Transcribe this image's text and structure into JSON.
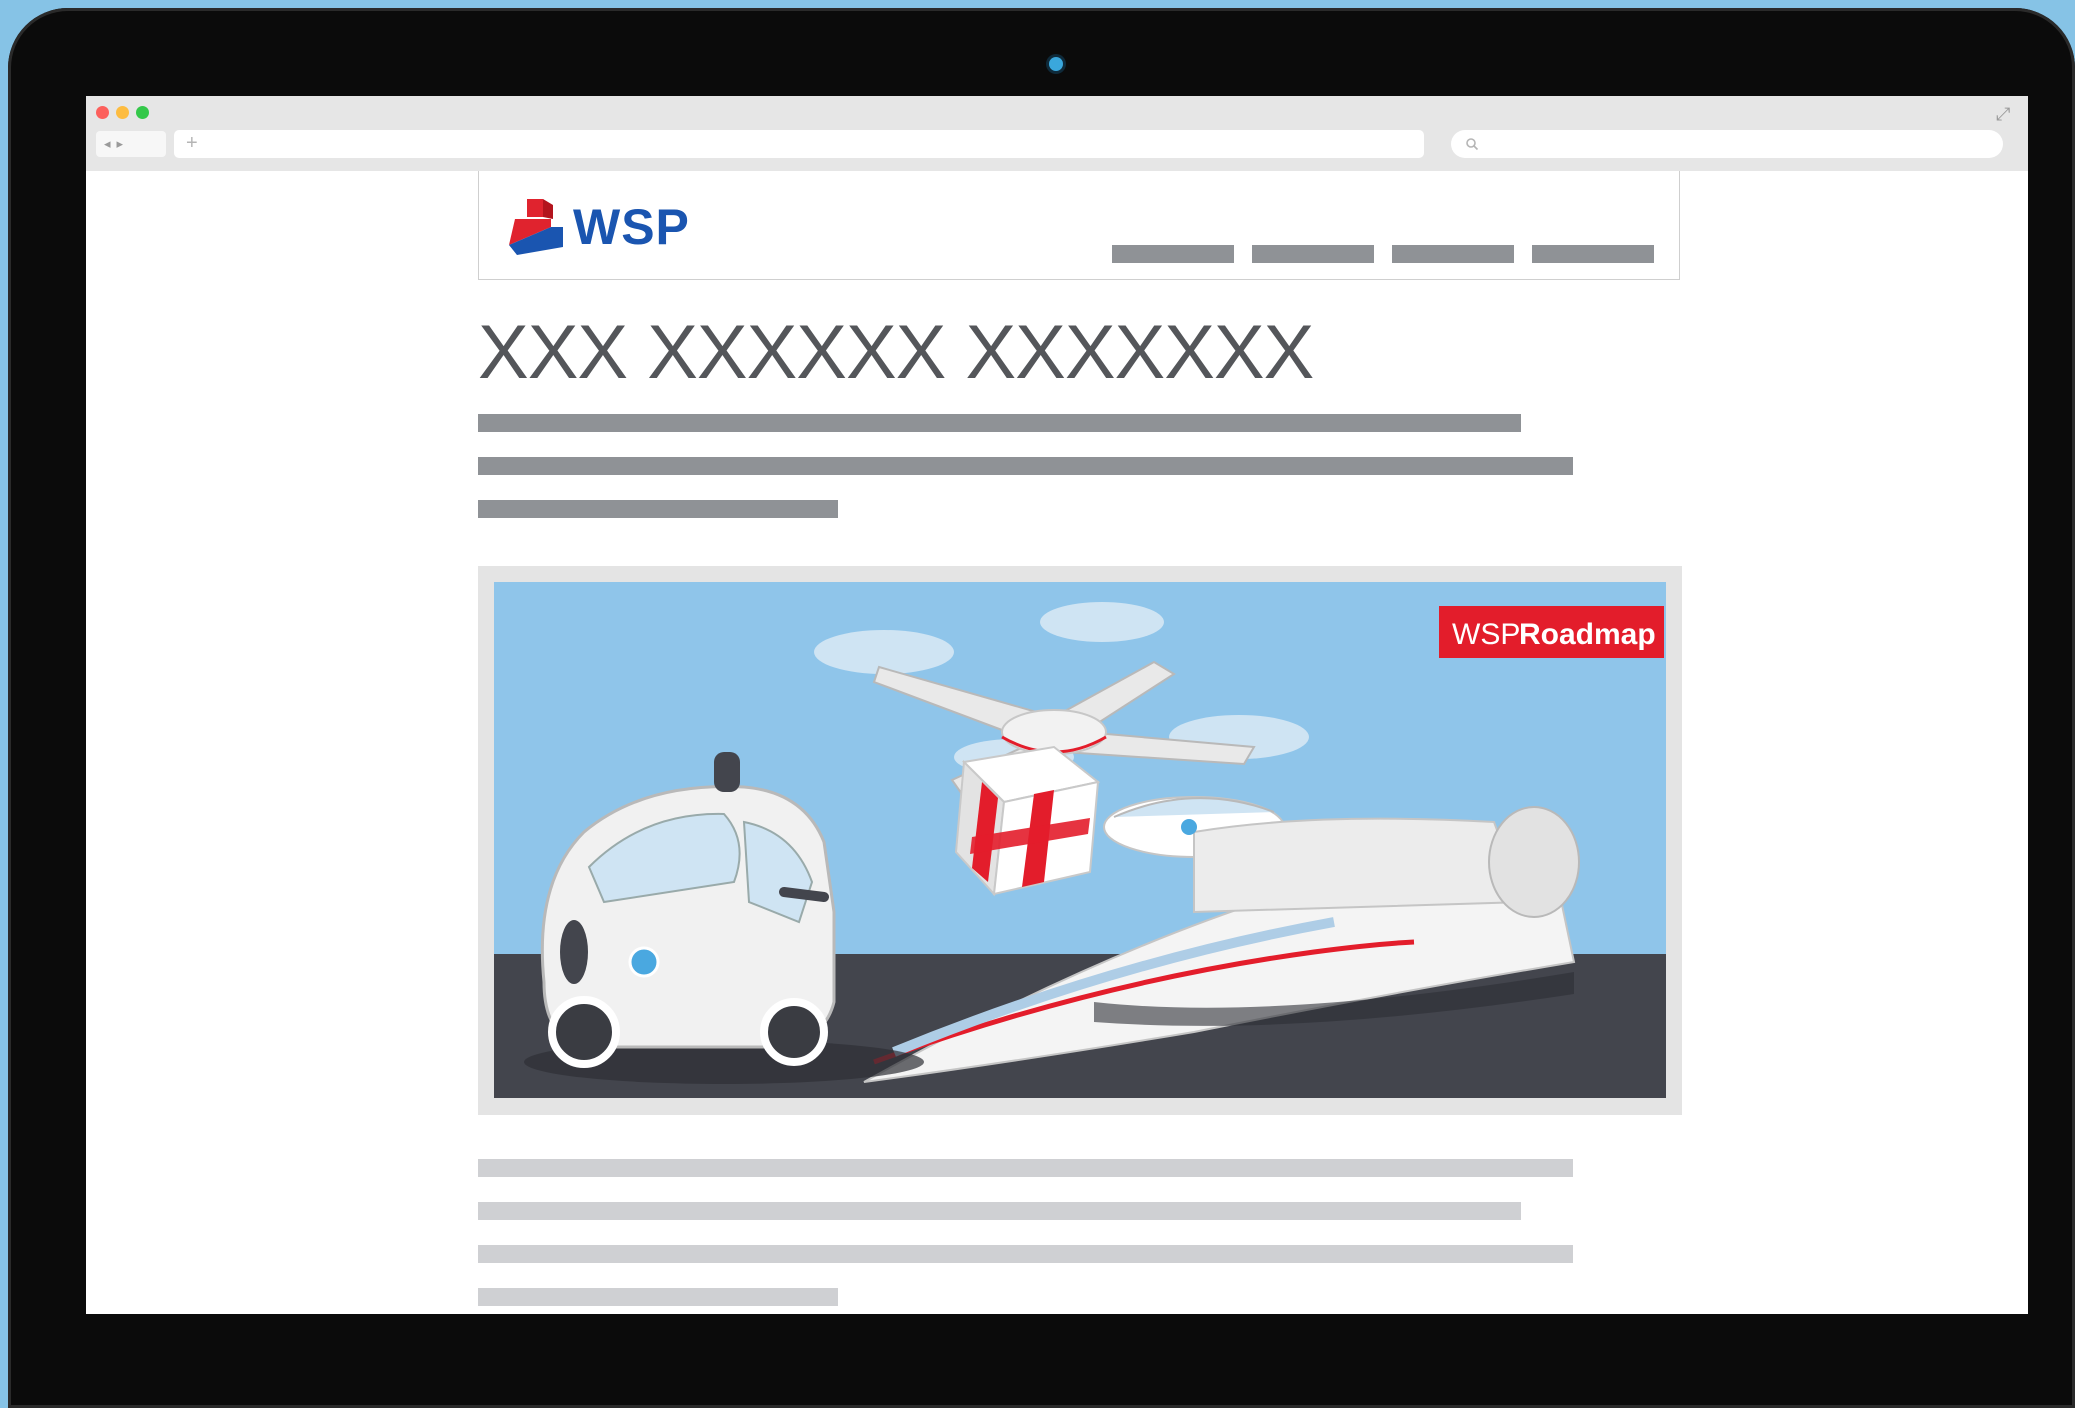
{
  "browser": {
    "back_icon": "back-arrow-icon",
    "forward_icon": "forward-arrow-icon",
    "new_tab_symbol": "+",
    "search_icon": "magnifier-icon",
    "expand_icon": "expand-arrows-icon"
  },
  "site": {
    "logo_text": "WSP",
    "logo_colors": {
      "red": "#e0232e",
      "blue": "#1a55b0"
    },
    "nav_items": [
      "",
      "",
      "",
      ""
    ]
  },
  "article": {
    "title": "XXX XXXXXX XXXXXXX",
    "intro_lines": 3,
    "body_lines": 4
  },
  "hero_image": {
    "badge_text_light": "WSP",
    "badge_text_bold": "Roadmap",
    "badge_color": "#e31d2b",
    "sky_color": "#8fc5ea",
    "road_color": "#43454d",
    "subjects": [
      "drone",
      "gift-box",
      "self-driving-car",
      "high-speed-train"
    ]
  },
  "colors": {
    "background": "#86c3e6",
    "laptop_bezel": "#0b0b0b",
    "placeholder_dark": "#8f9296",
    "placeholder_light": "#cfd0d3"
  }
}
